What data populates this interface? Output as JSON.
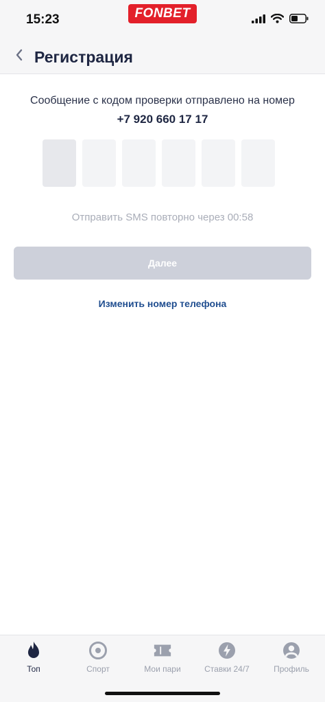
{
  "status_bar": {
    "time": "15:23",
    "brand": "FONBET"
  },
  "header": {
    "title": "Регистрация"
  },
  "verification": {
    "message": "Сообщение с кодом проверки отправлено на номер",
    "phone": "+7 920 660 17 17",
    "resend_text": "Отправить SMS повторно через 00:58"
  },
  "actions": {
    "next_label": "Далее",
    "change_phone_label": "Изменить номер телефона"
  },
  "tabs": [
    {
      "label": "Топ",
      "icon": "flame-icon"
    },
    {
      "label": "Спорт",
      "icon": "sport-icon"
    },
    {
      "label": "Мои пари",
      "icon": "ticket-icon"
    },
    {
      "label": "Ставки 24/7",
      "icon": "lightning-icon"
    },
    {
      "label": "Профиль",
      "icon": "profile-icon"
    }
  ],
  "colors": {
    "brand": "#e3202a",
    "primary_text": "#1e2642",
    "link": "#1f4d8f",
    "disabled_button": "#cdd0da",
    "muted": "#a9adb8"
  }
}
